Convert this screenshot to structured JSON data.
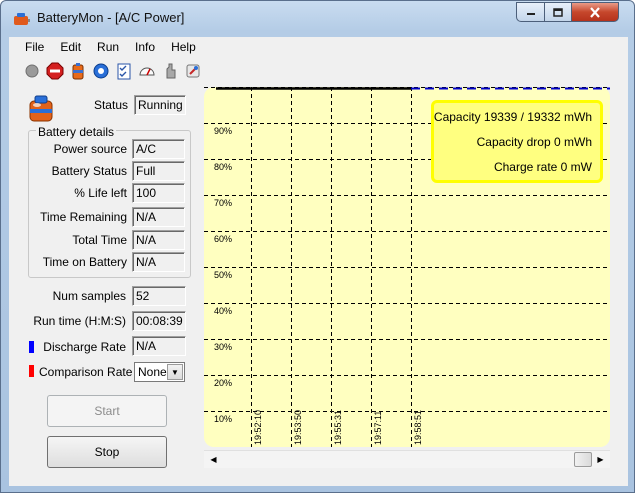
{
  "window": {
    "title": "BatteryMon - [A/C Power]",
    "accent": "#b4cce6",
    "close_color": "#c6472c"
  },
  "menu": [
    "File",
    "Edit",
    "Run",
    "Info",
    "Help"
  ],
  "toolbar": {
    "icons": [
      "record-icon",
      "stop-icon",
      "battery-icon",
      "settings-icon",
      "checklist-icon",
      "gauge-icon",
      "hand-icon",
      "tools-icon"
    ]
  },
  "status": {
    "label": "Status",
    "value": "Running"
  },
  "battery_details": {
    "title": "Battery details",
    "fields": [
      {
        "label": "Power source",
        "value": "A/C"
      },
      {
        "label": "Battery Status",
        "value": "Full"
      },
      {
        "label": "% Life left",
        "value": "100"
      },
      {
        "label": "Time Remaining",
        "value": "N/A"
      },
      {
        "label": "Total Time",
        "value": "N/A"
      },
      {
        "label": "Time on Battery",
        "value": "N/A"
      }
    ]
  },
  "num_samples": {
    "label": "Num samples",
    "value": "52"
  },
  "run_time": {
    "label": "Run time (H:M:S)",
    "value": "00:08:39"
  },
  "discharge_rate": {
    "label": "Discharge Rate",
    "value": "N/A",
    "color": "#0000ff"
  },
  "comparison_rate": {
    "label": "Comparison Rate",
    "value": "None",
    "color": "#ff0000"
  },
  "buttons": {
    "start": "Start",
    "stop": "Stop"
  },
  "chart": {
    "background": "#ffffc0",
    "y_ticks": [
      "90%",
      "80%",
      "70%",
      "60%",
      "50%",
      "40%",
      "30%",
      "20%",
      "10%"
    ],
    "x_ticks": [
      "19:52:10",
      "19:53:50",
      "19:55:31",
      "19:57:11",
      "19:58:51"
    ],
    "legend": [
      "Capacity 19339 / 19332 mWh",
      "Capacity drop 0 mWh",
      "Charge rate 0 mW"
    ],
    "top_trace_percent": 100
  }
}
